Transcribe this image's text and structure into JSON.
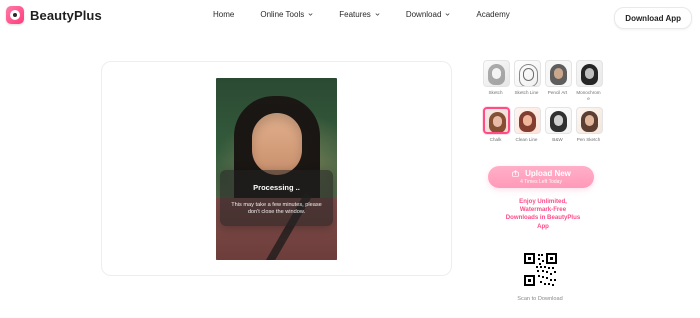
{
  "header": {
    "brand": "BeautyPlus",
    "nav": [
      {
        "label": "Home",
        "has_dropdown": false
      },
      {
        "label": "Online Tools",
        "has_dropdown": true
      },
      {
        "label": "Features",
        "has_dropdown": true
      },
      {
        "label": "Download",
        "has_dropdown": true
      },
      {
        "label": "Academy",
        "has_dropdown": false
      }
    ],
    "cta": "Download App",
    "icons": {
      "logo": "beautyplus-logo",
      "chevron": "chevron-down-icon"
    }
  },
  "editor": {
    "processing_title": "Processing ..",
    "processing_message": "This may take a few minutes,\nplease don't close the window."
  },
  "styles": {
    "items": [
      {
        "label": "Sketch",
        "variant": "sketch",
        "selected": false
      },
      {
        "label": "Sketch Line",
        "variant": "line",
        "selected": false
      },
      {
        "label": "Pencil Art",
        "variant": "pencil",
        "selected": false
      },
      {
        "label": "Monochrom\ne",
        "variant": "mono",
        "selected": false
      },
      {
        "label": "Chalk",
        "variant": "chalk",
        "selected": true
      },
      {
        "label": "Clean Line",
        "variant": "clean",
        "selected": false
      },
      {
        "label": "B&W",
        "variant": "bw",
        "selected": false
      },
      {
        "label": "Pen Sketch",
        "variant": "pen",
        "selected": false
      }
    ]
  },
  "upload": {
    "label": "Upload New",
    "sub": "4 Times Left Today",
    "icon": "upload-icon"
  },
  "promo": {
    "line1": "Enjoy Unlimited,",
    "line2": "Watermark-Free",
    "line3": "Downloads in",
    "brand": "BeautyPlus",
    "line4": "App"
  },
  "download": {
    "scan_text": "Scan to Download",
    "qr_icon": "qr-code"
  },
  "colors": {
    "accent": "#ff4b86",
    "accent_soft": "#ff9ab9"
  }
}
